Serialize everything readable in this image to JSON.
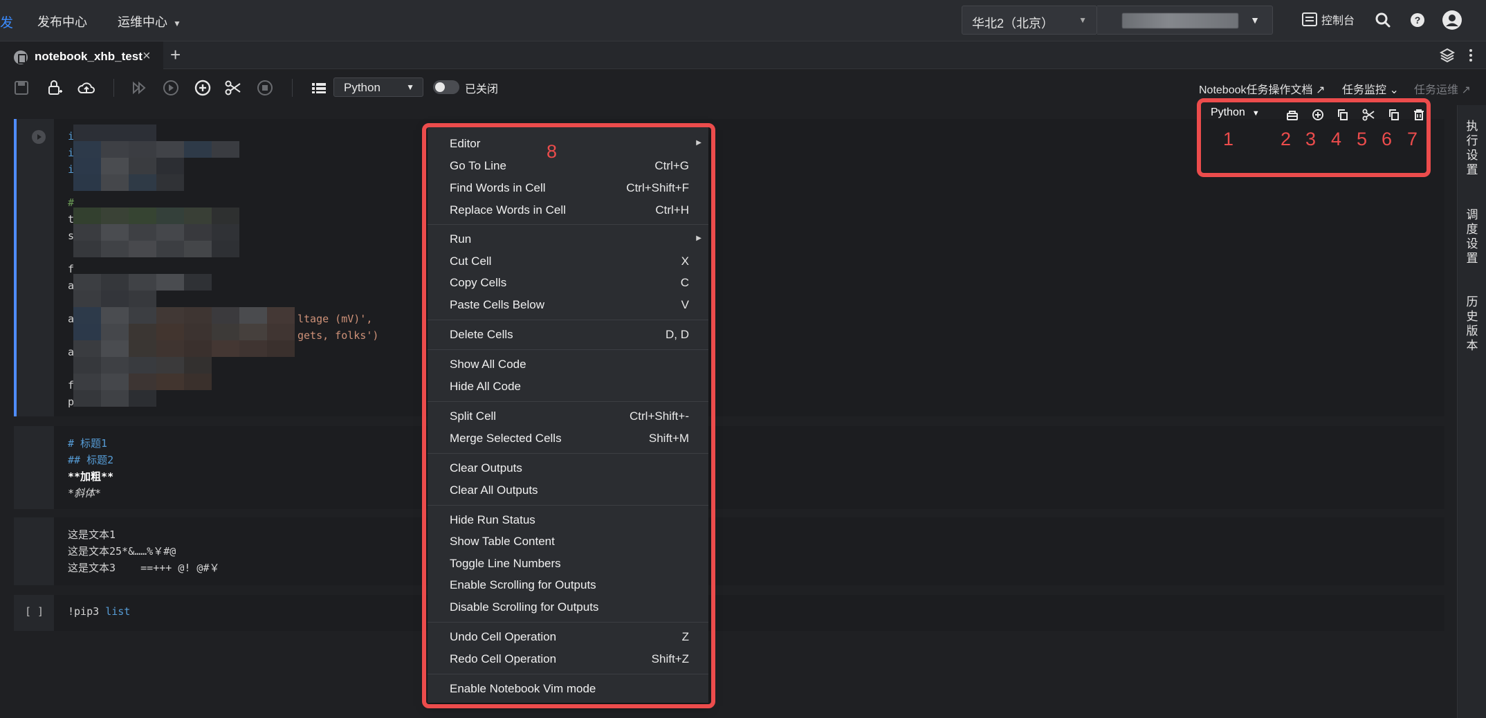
{
  "topnav": {
    "edge_char": "发",
    "publish": "发布中心",
    "ops": "运维中心",
    "region": "华北2（北京）",
    "console": "控制台"
  },
  "tab": {
    "title": "notebook_xhb_test"
  },
  "toolbar": {
    "kernel": "Python",
    "toggle_label": "已关闭",
    "doc_link": "Notebook任务操作文档 ↗",
    "monitor": "任务监控 ⌄",
    "ops_link": "任务运维 ↗"
  },
  "sidebar": {
    "exec_settings": "执行设置",
    "schedule_settings": "调度设置",
    "history": "历史版本"
  },
  "cells": {
    "code1": {
      "prefixes": [
        "i",
        "i",
        "i",
        "#",
        "t",
        "s",
        "f",
        "a",
        "a",
        "a",
        "f",
        "p"
      ],
      "frag1": "ltage (mV)',",
      "frag2": "gets, folks')"
    },
    "markdown": {
      "h1": "# 标题1",
      "h2": "## 标题2",
      "bold": "**加粗**",
      "italic": "*斜体*"
    },
    "text": {
      "l1": "这是文本1",
      "l2": "这是文本25*&……%￥#@",
      "l3": "这是文本3    ==+++ @! @#￥"
    },
    "pip": {
      "prompt": "[ ]",
      "cmd": "!pip3 ",
      "arg": "list"
    }
  },
  "mini_toolbar": {
    "kernel": "Python"
  },
  "annotations": {
    "n1": "1",
    "n2": "2",
    "n3": "3",
    "n4": "4",
    "n5": "5",
    "n6": "6",
    "n7": "7",
    "n8": "8"
  },
  "context_menu": {
    "editor": "Editor",
    "goto": {
      "label": "Go To Line",
      "sc": "Ctrl+G"
    },
    "find": {
      "label": "Find Words in Cell",
      "sc": "Ctrl+Shift+F"
    },
    "replace": {
      "label": "Replace Words in Cell",
      "sc": "Ctrl+H"
    },
    "run": "Run",
    "cut": {
      "label": "Cut Cell",
      "sc": "X"
    },
    "copy": {
      "label": "Copy Cells",
      "sc": "C"
    },
    "paste": {
      "label": "Paste Cells Below",
      "sc": "V"
    },
    "delete": {
      "label": "Delete Cells",
      "sc": "D, D"
    },
    "show_code": "Show All Code",
    "hide_code": "Hide All Code",
    "split": {
      "label": "Split Cell",
      "sc": "Ctrl+Shift+-"
    },
    "merge": {
      "label": "Merge Selected Cells",
      "sc": "Shift+M"
    },
    "clear_outputs": "Clear Outputs",
    "clear_all": "Clear All Outputs",
    "hide_run": "Hide Run Status",
    "show_table": "Show Table Content",
    "toggle_lines": "Toggle Line Numbers",
    "enable_scroll": "Enable Scrolling for Outputs",
    "disable_scroll": "Disable Scrolling for Outputs",
    "undo": {
      "label": "Undo Cell Operation",
      "sc": "Z"
    },
    "redo": {
      "label": "Redo Cell Operation",
      "sc": "Shift+Z"
    },
    "vim": "Enable Notebook Vim mode"
  },
  "colors": {
    "annotation_red": "#ec4c4c",
    "accent_blue": "#4f8cff",
    "code_string": "#ce9178",
    "code_keyword": "#569cd6"
  }
}
